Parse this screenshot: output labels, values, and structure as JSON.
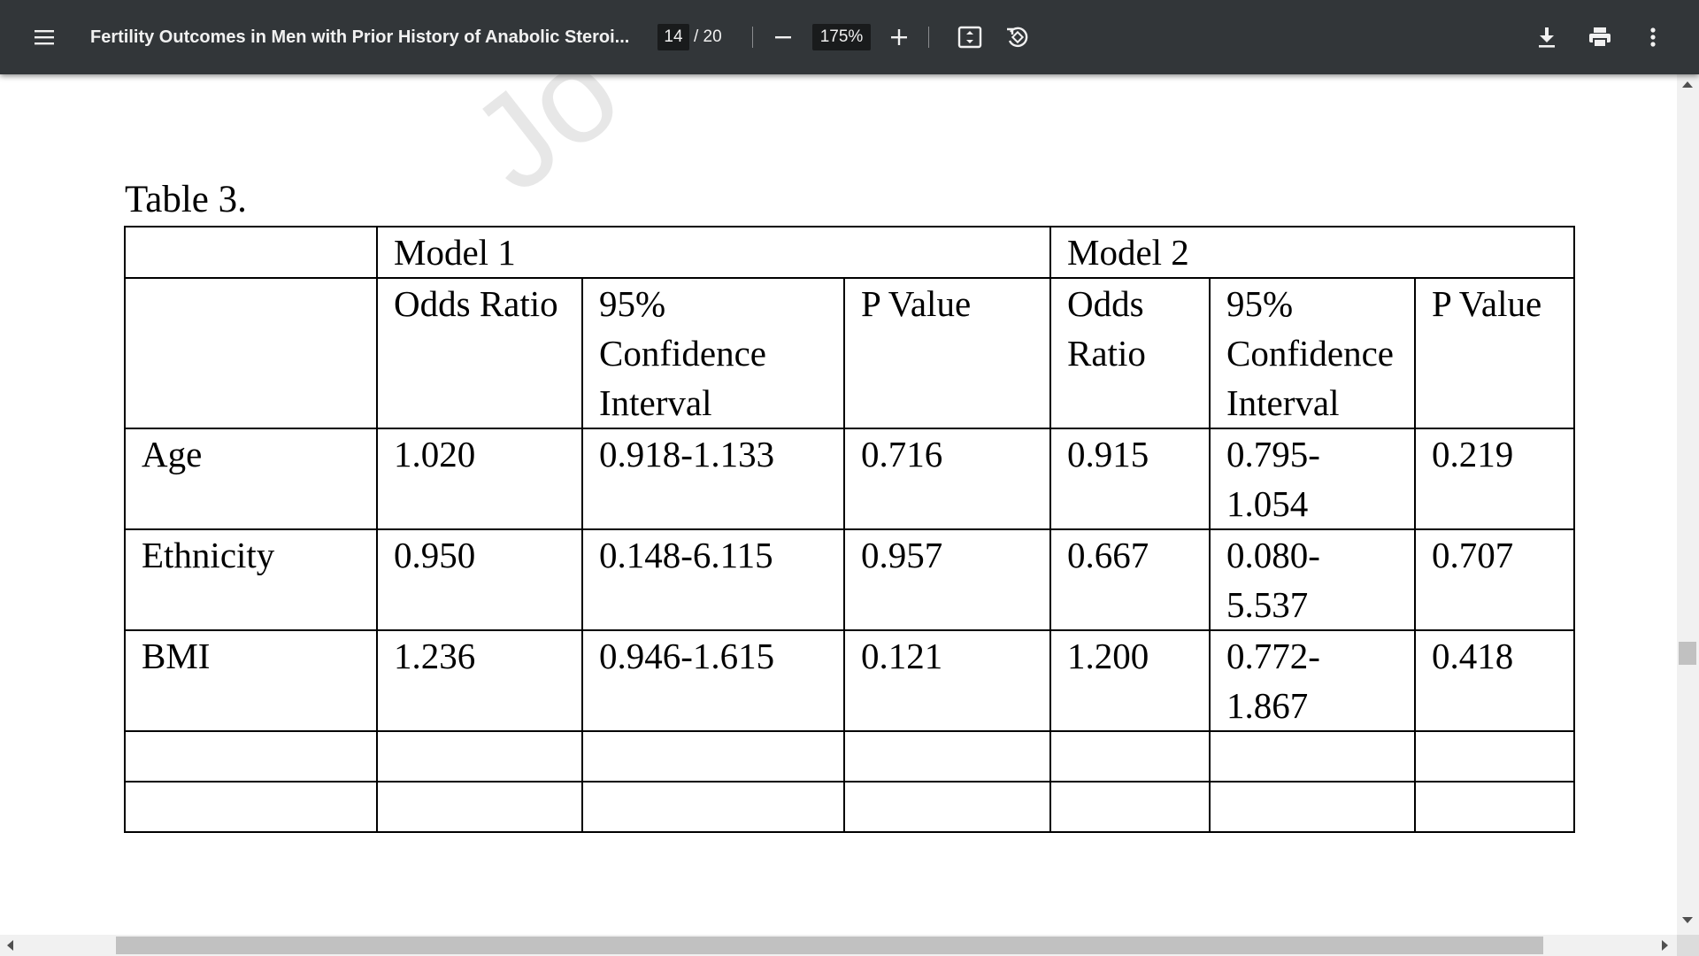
{
  "toolbar": {
    "title": "Fertility Outcomes in Men with Prior History of Anabolic Steroi...",
    "current_page": "14",
    "total_pages": "/ 20",
    "zoom": "175%",
    "icons": [
      "menu-icon",
      "zoom-out-icon",
      "zoom-in-icon",
      "fit-page-icon",
      "rotate-icon",
      "download-icon",
      "print-icon",
      "more-options-icon"
    ]
  },
  "document": {
    "watermark": "Jo",
    "caption": "Table 3.",
    "table": {
      "group_headers": [
        "",
        "Model 1",
        "Model 2"
      ],
      "column_headers": [
        "",
        "Odds Ratio",
        "95% Confidence Interval",
        "P Value",
        "Odds Ratio",
        "95% Confidence Interval",
        "P Value"
      ],
      "rows": [
        [
          "Age",
          "1.020",
          "0.918-1.133",
          "0.716",
          "0.915",
          "0.795-1.054",
          "0.219"
        ],
        [
          "Ethnicity",
          "0.950",
          "0.148-6.115",
          "0.957",
          "0.667",
          "0.080-5.537",
          "0.707"
        ],
        [
          "BMI",
          "1.236",
          "0.946-1.615",
          "0.121",
          "1.200",
          "0.772-1.867",
          "0.418"
        ],
        [
          "",
          "",
          "",
          "",
          "",
          "",
          ""
        ],
        [
          "",
          "",
          "",
          "",
          "",
          "",
          ""
        ]
      ]
    }
  },
  "colors": {
    "toolbar_bg": "#323639",
    "toolbar_text": "#f1f1f1",
    "input_bg": "#191b1c",
    "page_bg": "#ffffff"
  }
}
